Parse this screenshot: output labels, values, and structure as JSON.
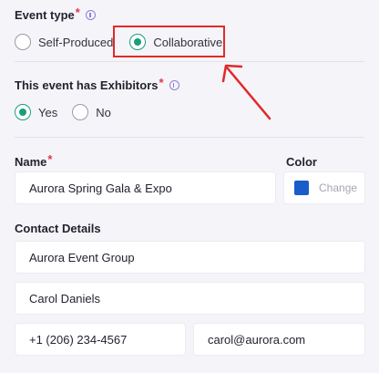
{
  "event_type": {
    "label": "Event type",
    "required_mark": "*",
    "options": [
      {
        "label": "Self-Produced",
        "selected": false
      },
      {
        "label": "Collaborative",
        "selected": true
      }
    ]
  },
  "exhibitors": {
    "label": "This event has Exhibitors",
    "required_mark": "*",
    "options": [
      {
        "label": "Yes",
        "selected": true
      },
      {
        "label": "No",
        "selected": false
      }
    ]
  },
  "name": {
    "label": "Name",
    "required_mark": "*",
    "value": "Aurora Spring Gala & Expo"
  },
  "color": {
    "label": "Color",
    "swatch": "#1a5cc9",
    "button_label": "Change"
  },
  "contact": {
    "label": "Contact Details",
    "organization": "Aurora Event Group",
    "person": "Carol Daniels",
    "phone": "+1 (206) 234-4567",
    "email": "carol@aurora.com"
  },
  "colors": {
    "accent": "#1a9d7c",
    "required": "#e0364b",
    "info": "#8f7fd6",
    "annotation": "#e02a2a"
  }
}
